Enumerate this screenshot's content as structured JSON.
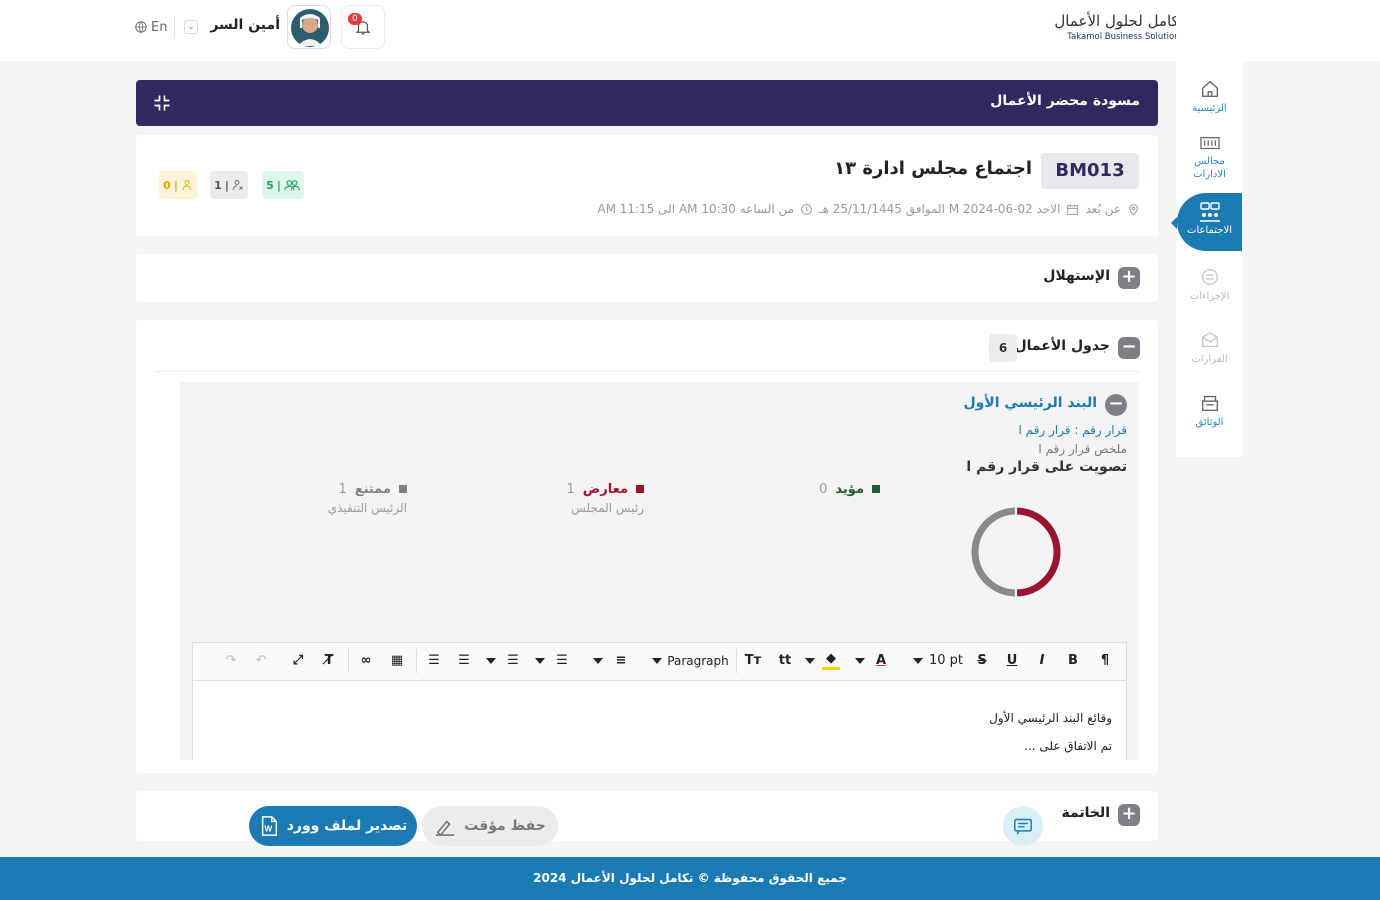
{
  "header": {
    "logo_ar": "تكامل لحلول الأعمال",
    "logo_en": "Takamol Business Solutions",
    "notification_count": "0",
    "user_name": "أمين السر",
    "lang": "En"
  },
  "sidebar": {
    "items": [
      {
        "label": "الرئيسية"
      },
      {
        "label": "مجالس الادارات"
      },
      {
        "label": "الاجتماعات"
      },
      {
        "label": "الإجراءات"
      },
      {
        "label": "القرارات"
      },
      {
        "label": "الوثائق"
      }
    ]
  },
  "banner": {
    "title": "مسودة محضر الأعمال"
  },
  "meeting": {
    "code": "BM013",
    "title": "اجتماع مجلس ادارة ١٣",
    "location": "عن بُعد",
    "date": "الاحد 02-06-2024 M الموافق 25/11/1445 هـ",
    "time": "من الساعه AM 10:30 الى AM 11:15",
    "badge_attendees": "5",
    "badge_absent": "1",
    "badge_pending": "0"
  },
  "sections": {
    "opening": "الإستهلال",
    "agenda": "جدول الأعمال",
    "agenda_count": "6",
    "closing": "الخاتمة"
  },
  "agenda_item": {
    "title": "البند الرئيسي الأول",
    "decision": "قرار رقم : قرار رقم ا",
    "summary": "ملخص قرار رقم ا",
    "vote_title": "تصويت على قرار رقم ا",
    "votes": [
      {
        "label": "مؤيد",
        "count": "0",
        "color": "#1f5c2e",
        "person": ""
      },
      {
        "label": "معارض",
        "count": "1",
        "color": "#9c1530",
        "person": "رئيس المجلس"
      },
      {
        "label": "ممتنع",
        "count": "1",
        "color": "#808080",
        "person": "الرئيس التنفيذي"
      }
    ]
  },
  "chart_data": {
    "type": "pie",
    "categories": [
      "مؤيد",
      "معارض",
      "ممتنع"
    ],
    "values": [
      0,
      1,
      1
    ],
    "colors": [
      "#1f5c2e",
      "#9c1530",
      "#8a8a8a"
    ]
  },
  "editor": {
    "font_size": "10 pt",
    "paragraph": "Paragraph",
    "line1": "وقائع البند الرئيسي الأول",
    "line2": "تم الاتفاق على ..."
  },
  "actions": {
    "save_draft": "حفظ مؤقت",
    "export_word": "تصدير لملف وورد"
  },
  "footer": {
    "text": "جميع الحقوق محفوظة © تكامل لحلول الأعمال 2024"
  }
}
